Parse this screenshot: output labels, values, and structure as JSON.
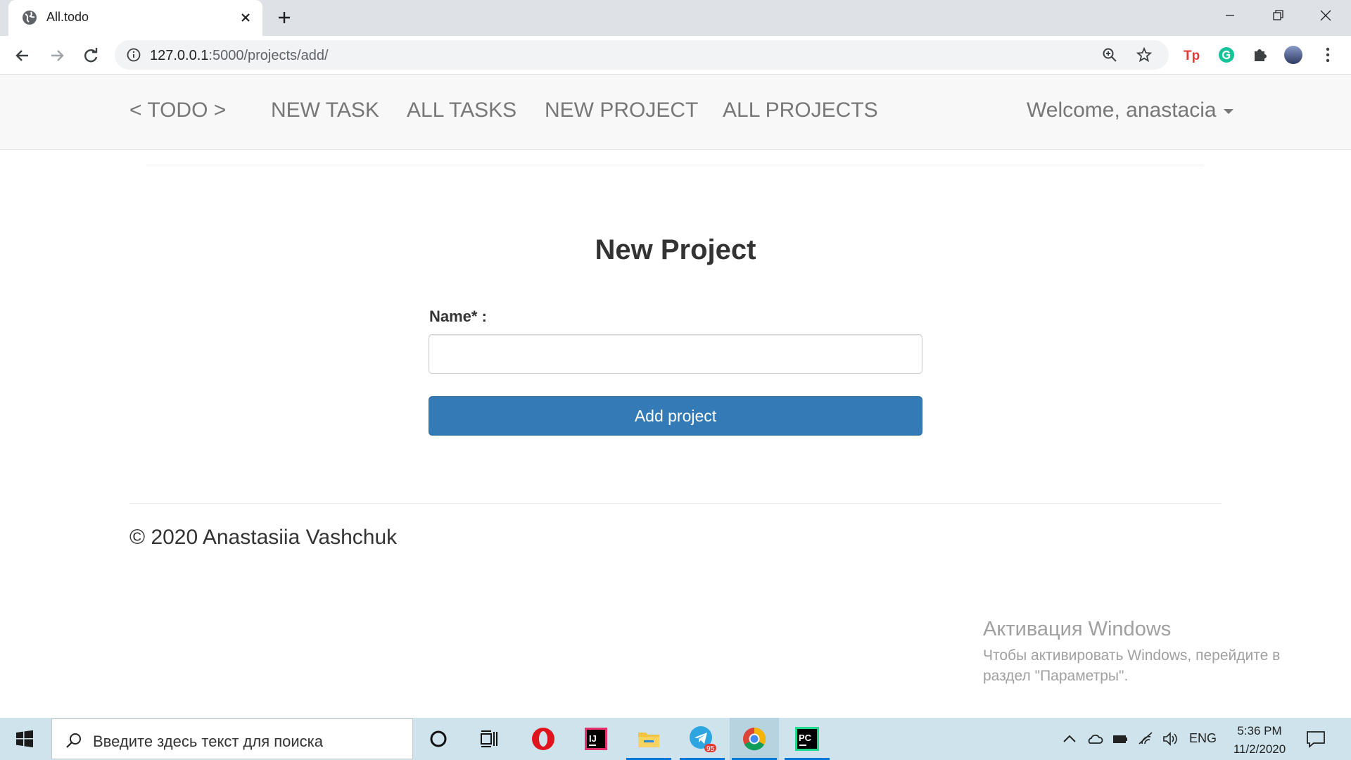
{
  "browser": {
    "tab_title": "All.todo",
    "url_host": "127.0.0.1",
    "url_rest": ":5000/projects/add/"
  },
  "navbar": {
    "brand": "< TODO >",
    "links": [
      "NEW TASK",
      "ALL TASKS",
      "NEW PROJECT",
      "ALL PROJECTS"
    ],
    "welcome": "Welcome, anastacia"
  },
  "form": {
    "title": "New Project",
    "name_label": "Name* :",
    "name_value": "",
    "submit_label": "Add project"
  },
  "footer": {
    "text": "© 2020 Anastasiia Vashchuk"
  },
  "watermark": {
    "title": "Активация Windows",
    "line1": "Чтобы активировать Windows, перейдите в",
    "line2": "раздел \"Параметры\"."
  },
  "taskbar": {
    "search_placeholder": "Введите здесь текст для поиска",
    "telegram_badge": "95",
    "language": "ENG",
    "time": "5:36 PM",
    "date": "11/2/2020"
  },
  "colors": {
    "primary_button": "#337ab7",
    "navbar_bg": "#f8f8f8",
    "taskbar_bg": "#cfe3ec"
  }
}
